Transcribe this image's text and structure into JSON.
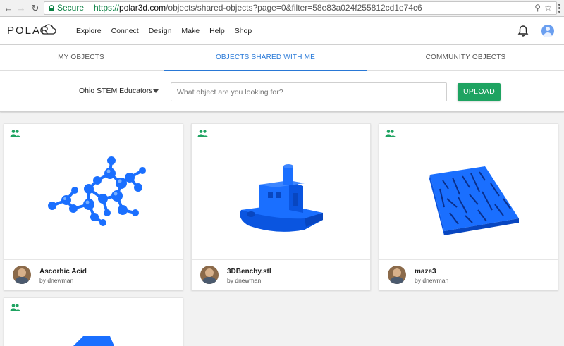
{
  "browser": {
    "secure_label": "Secure",
    "url_protocol": "https://",
    "url_host": "polar3d.com",
    "url_path": "/objects/shared-objects?page=0&filter=58e83a024f255812cd1e74c6"
  },
  "header": {
    "logo_text": "POLAR",
    "nav": [
      "Explore",
      "Connect",
      "Design",
      "Make",
      "Help",
      "Shop"
    ]
  },
  "tabs": [
    {
      "label": "MY OBJECTS"
    },
    {
      "label": "OBJECTS SHARED WITH ME"
    },
    {
      "label": "COMMUNITY OBJECTS"
    }
  ],
  "filters": {
    "group_selected": "Ohio STEM Educators",
    "search_placeholder": "What object are you looking for?",
    "upload_label": "UPLOAD"
  },
  "objects": [
    {
      "name": "Ascorbic Acid",
      "owner": "by dnewman"
    },
    {
      "name": "3DBenchy.stl",
      "owner": "by dnewman"
    },
    {
      "name": "maze3",
      "owner": "by dnewman"
    }
  ],
  "colors": {
    "accent_blue": "#2a7ad8",
    "upload_green": "#1ea361",
    "share_green": "#1ea361",
    "model_blue": "#1a6fff"
  }
}
